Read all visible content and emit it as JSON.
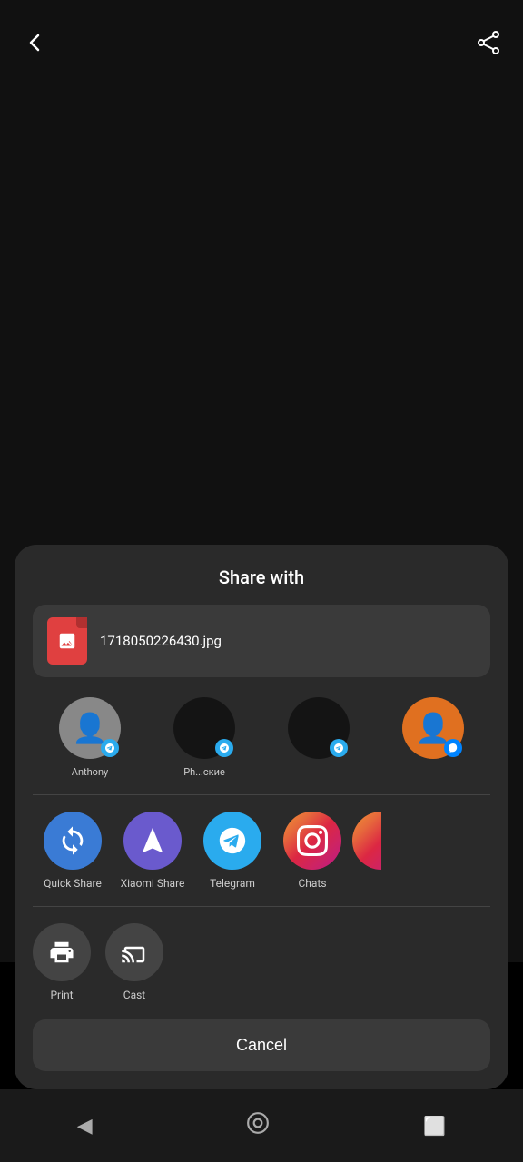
{
  "topBar": {
    "backLabel": "←",
    "shareLabel": "share"
  },
  "shareSheet": {
    "title": "Share with",
    "fileName": "1718050226430.jpg",
    "contacts": [
      {
        "id": 1,
        "name": "Anthony",
        "badge": "telegram",
        "avatarType": "default"
      },
      {
        "id": 2,
        "name": "Ph...cкие",
        "badge": "telegram",
        "avatarType": "dark-overlay"
      },
      {
        "id": 3,
        "name": "",
        "badge": "telegram",
        "avatarType": "dark-overlay"
      },
      {
        "id": 4,
        "name": "",
        "badge": "messenger",
        "avatarType": "orange"
      }
    ],
    "apps": [
      {
        "id": "quickshare",
        "label": "Quick Share",
        "iconType": "quickshare"
      },
      {
        "id": "xiaomishare",
        "label": "Xiaomi Share",
        "iconType": "xiaomi"
      },
      {
        "id": "telegram",
        "label": "Telegram",
        "iconType": "telegram"
      },
      {
        "id": "chats",
        "label": "Chats",
        "iconType": "instagram"
      },
      {
        "id": "more",
        "label": "",
        "iconType": "partial"
      }
    ],
    "actions": [
      {
        "id": "print",
        "label": "Print",
        "icon": "print"
      },
      {
        "id": "cast",
        "label": "Cast",
        "icon": "cast"
      }
    ],
    "cancelLabel": "Cancel"
  },
  "navBar": {
    "backIcon": "◀",
    "homeIcon": "⏺",
    "recentIcon": "⬜"
  }
}
